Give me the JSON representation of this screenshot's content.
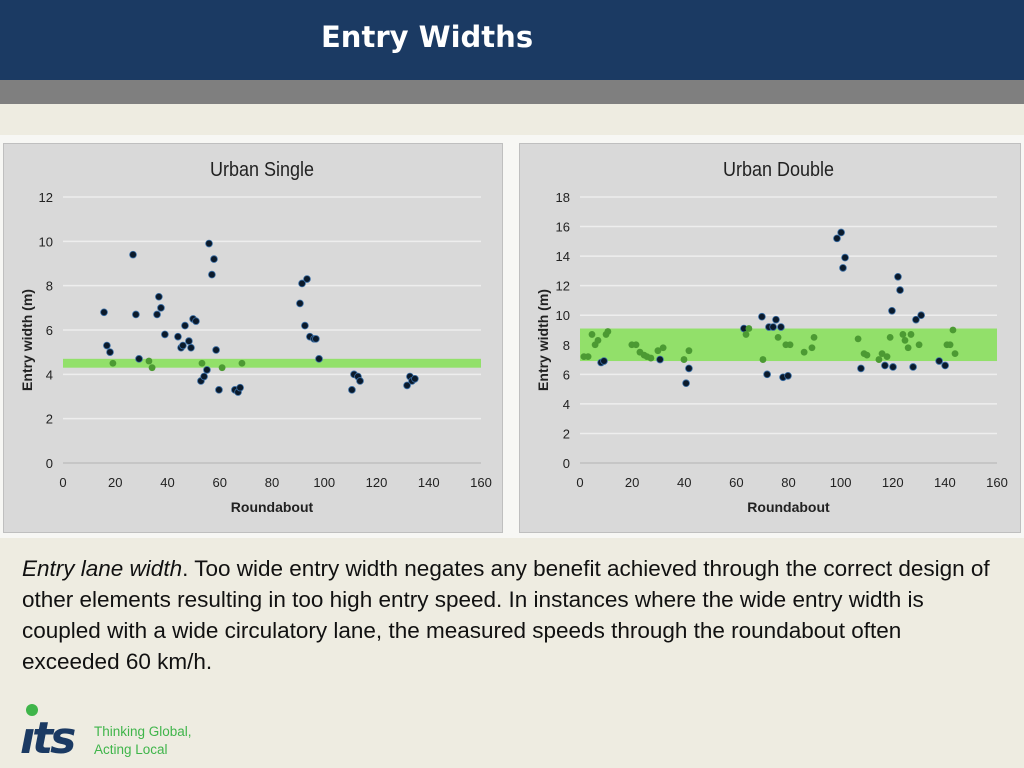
{
  "header": {
    "title": "Entry Widths"
  },
  "caption": {
    "lead": "Entry lane width",
    "body": ".  Too wide entry width negates any benefit achieved through the correct design of other elements resulting in too high entry speed.  In instances where the wide entry width is coupled with a wide circulatory lane, the measured speeds through the roundabout often exceeded 60 km/h."
  },
  "logo": {
    "text": "its",
    "tagline_1": "Thinking Global,",
    "tagline_2": "Acting Local",
    "dot_color": "#3fb54a",
    "text_color": "#1b3a63"
  },
  "colors": {
    "band": "#92e06a",
    "point_outside": "#0b1a2b",
    "point_inside": "#4c9a33",
    "panel_bg": "#d9d9d9",
    "grid": "#eeeeee"
  },
  "chart_data": [
    {
      "type": "scatter",
      "title": "Urban Single",
      "xlabel": "Roundabout",
      "ylabel": "Entry width (m)",
      "xlim": [
        0,
        160
      ],
      "ylim": [
        0,
        12
      ],
      "xticks": [
        "0",
        "20",
        "40",
        "60",
        "80",
        "100",
        "120",
        "140",
        "160"
      ],
      "yticks": [
        "0",
        "2",
        "4",
        "6",
        "8",
        "10",
        "12"
      ],
      "grid": true,
      "band": [
        4.3,
        4.7
      ],
      "points_within_band": [
        [
          19.1,
          4.5
        ],
        [
          32.9,
          4.6
        ],
        [
          34.1,
          4.3
        ],
        [
          53.2,
          4.5
        ],
        [
          60.9,
          4.3
        ],
        [
          68.5,
          4.5
        ]
      ],
      "points_outside_band": [
        [
          15.7,
          6.8
        ],
        [
          16.8,
          5.3
        ],
        [
          18.0,
          5.0
        ],
        [
          26.8,
          9.4
        ],
        [
          27.9,
          6.7
        ],
        [
          29.1,
          4.7
        ],
        [
          36.0,
          6.7
        ],
        [
          36.7,
          7.5
        ],
        [
          37.5,
          7.0
        ],
        [
          39.0,
          5.8
        ],
        [
          44.0,
          5.7
        ],
        [
          45.2,
          5.2
        ],
        [
          45.9,
          5.3
        ],
        [
          46.7,
          6.2
        ],
        [
          48.2,
          5.5
        ],
        [
          49.0,
          5.2
        ],
        [
          49.8,
          6.5
        ],
        [
          50.9,
          6.4
        ],
        [
          52.8,
          3.7
        ],
        [
          54.0,
          3.9
        ],
        [
          55.1,
          4.2
        ],
        [
          55.9,
          9.9
        ],
        [
          57.0,
          8.5
        ],
        [
          57.8,
          9.2
        ],
        [
          58.6,
          5.1
        ],
        [
          59.7,
          3.3
        ],
        [
          65.8,
          3.3
        ],
        [
          67.0,
          3.2
        ],
        [
          67.8,
          3.4
        ],
        [
          90.7,
          7.2
        ],
        [
          91.5,
          8.1
        ],
        [
          93.4,
          8.3
        ],
        [
          92.6,
          6.2
        ],
        [
          94.5,
          5.7
        ],
        [
          96.1,
          5.6
        ],
        [
          96.8,
          5.6
        ],
        [
          98.0,
          4.7
        ],
        [
          110.6,
          3.3
        ],
        [
          111.4,
          4.0
        ],
        [
          112.9,
          3.9
        ],
        [
          113.7,
          3.7
        ],
        [
          131.7,
          3.5
        ],
        [
          132.8,
          3.9
        ],
        [
          133.6,
          3.7
        ],
        [
          134.7,
          3.8
        ]
      ]
    },
    {
      "type": "scatter",
      "title": "Urban Double",
      "xlabel": "Roundabout",
      "ylabel": "Entry width (m)",
      "xlim": [
        0,
        160
      ],
      "ylim": [
        0,
        18
      ],
      "xticks": [
        "0",
        "20",
        "40",
        "60",
        "80",
        "100",
        "120",
        "140",
        "160"
      ],
      "yticks": [
        "0",
        "2",
        "4",
        "6",
        "8",
        "10",
        "12",
        "14",
        "16",
        "18"
      ],
      "grid": true,
      "band": [
        6.9,
        9.1
      ],
      "points_within_band": [
        [
          1.5,
          7.2
        ],
        [
          3.1,
          7.2
        ],
        [
          4.6,
          8.7
        ],
        [
          5.8,
          8.0
        ],
        [
          6.9,
          8.3
        ],
        [
          10.0,
          8.7
        ],
        [
          10.7,
          8.9
        ],
        [
          19.9,
          8.0
        ],
        [
          21.5,
          8.0
        ],
        [
          23.0,
          7.5
        ],
        [
          24.6,
          7.3
        ],
        [
          25.7,
          7.2
        ],
        [
          27.2,
          7.1
        ],
        [
          29.9,
          7.6
        ],
        [
          31.9,
          7.8
        ],
        [
          39.9,
          7.0
        ],
        [
          41.8,
          7.6
        ],
        [
          63.7,
          8.7
        ],
        [
          64.8,
          9.1
        ],
        [
          70.2,
          7.0
        ],
        [
          76.0,
          8.5
        ],
        [
          79.0,
          8.0
        ],
        [
          80.6,
          8.0
        ],
        [
          86.0,
          7.5
        ],
        [
          89.0,
          7.8
        ],
        [
          89.8,
          8.5
        ],
        [
          106.7,
          8.4
        ],
        [
          109.0,
          7.4
        ],
        [
          110.1,
          7.3
        ],
        [
          114.7,
          7.0
        ],
        [
          115.9,
          7.4
        ],
        [
          117.8,
          7.2
        ],
        [
          119.0,
          8.5
        ],
        [
          123.9,
          8.7
        ],
        [
          124.7,
          8.3
        ],
        [
          125.9,
          7.8
        ],
        [
          127.0,
          8.7
        ],
        [
          130.1,
          8.0
        ],
        [
          140.8,
          8.0
        ],
        [
          142.0,
          8.0
        ],
        [
          143.1,
          9.0
        ],
        [
          143.9,
          7.4
        ]
      ],
      "points_outside_band": [
        [
          8.1,
          6.8
        ],
        [
          9.2,
          6.9
        ],
        [
          30.7,
          7.0
        ],
        [
          40.7,
          5.4
        ],
        [
          41.8,
          6.4
        ],
        [
          62.9,
          9.1
        ],
        [
          69.8,
          9.9
        ],
        [
          71.8,
          6.0
        ],
        [
          72.5,
          9.2
        ],
        [
          74.1,
          9.2
        ],
        [
          75.2,
          9.7
        ],
        [
          77.1,
          9.2
        ],
        [
          77.9,
          5.8
        ],
        [
          79.8,
          5.9
        ],
        [
          98.6,
          15.2
        ],
        [
          100.2,
          15.6
        ],
        [
          101.7,
          13.9
        ],
        [
          100.9,
          13.2
        ],
        [
          107.8,
          6.4
        ],
        [
          117.0,
          6.6
        ],
        [
          119.7,
          10.3
        ],
        [
          120.1,
          6.5
        ],
        [
          122.0,
          12.6
        ],
        [
          122.8,
          11.7
        ],
        [
          127.8,
          6.5
        ],
        [
          128.9,
          9.7
        ],
        [
          130.9,
          10.0
        ],
        [
          137.8,
          6.9
        ],
        [
          140.1,
          6.6
        ]
      ]
    }
  ]
}
